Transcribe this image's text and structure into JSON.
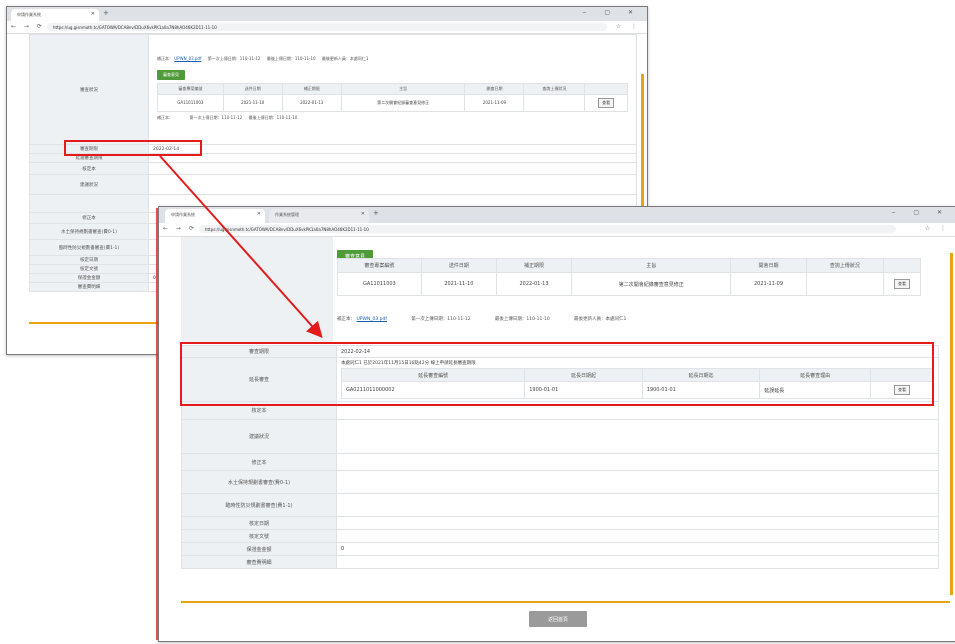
{
  "back_window": {
    "tab_title": "申請作業系統",
    "url": "https://ug.gisnmoth.tc/GATOWA/DCA8nv/DDuX6vkPK1a0a7N8hAO46K2D11-11-10"
  },
  "front_window": {
    "tabs": [
      "申請作業系統",
      "作業系統管理"
    ],
    "url": "https://ug.gisnmoth.tc/GATOWA/DCA8nv/DDuX6vkPK1a0a7N8hAO46K2D11-11-10"
  },
  "review": {
    "button_label": "審查意見",
    "headers": [
      "審查專案編號",
      "送件日期",
      "補正期限",
      "主旨",
      "開會日期",
      "查詢上傳狀況"
    ],
    "rows": [
      [
        "GA11011003",
        "2021-11-10",
        "2022-01-13",
        "第二次開會紀錄審查意見修正",
        "2021-11-09",
        ""
      ]
    ],
    "action_label": "查看",
    "links": {
      "prefix": "補正本：",
      "file": "UPWN_03.pdf",
      "first_upload": "第一次上傳日期：110-11-12",
      "latest_upload": "最後上傳日期：110-11-10",
      "latest_uploader": "最後更新人員：本處同仁1"
    }
  },
  "back_labels": {
    "status": "審查狀況",
    "date": "審查期限",
    "date_value": "2022-02-14",
    "late": "延遲審查期限",
    "corr": "核定本",
    "result": "建議狀況",
    "version": "修正本",
    "loc_fee": "水土保持規劃書審查(費0-1)",
    "fee2": "臨時性防災規劃書審查(費1-1)",
    "approve_date": "核定日期",
    "approve_doc": "核定文號",
    "total": "保證金金額",
    "total_value": "0",
    "review_org": "審查費明細"
  },
  "front_labels": {
    "date": "審查期限",
    "date_value": "2022-02-14",
    "extension": "延長審查",
    "extension_note": "本處同仁1 已於2021年11月15日16點42分 線上申請延長審查期限",
    "ext_headers": [
      "延長審查編號",
      "延長日期起",
      "延長日期迄",
      "延長審查理由"
    ],
    "ext_row": [
      "GA0211011000002",
      "1900-01-01",
      "1900-01-01",
      "延誤延長"
    ],
    "ext_action": "查看",
    "corr": "核定本",
    "result": "建議狀況",
    "version": "修正本",
    "fee1": "水土保持規劃書審查(費0-1)",
    "fee2": "臨時性防災規劃書審查(費1-1)",
    "approve_date": "核定日期",
    "approve_doc": "核定文號",
    "total": "保證金金額",
    "total_value": "0",
    "review_org": "審查費明細"
  },
  "footer": {
    "return_label": "返回首頁"
  },
  "colors": {
    "annotation_red": "#e31b1b",
    "accent_orange": "#e8a317",
    "button_green": "#4f9b3a"
  }
}
